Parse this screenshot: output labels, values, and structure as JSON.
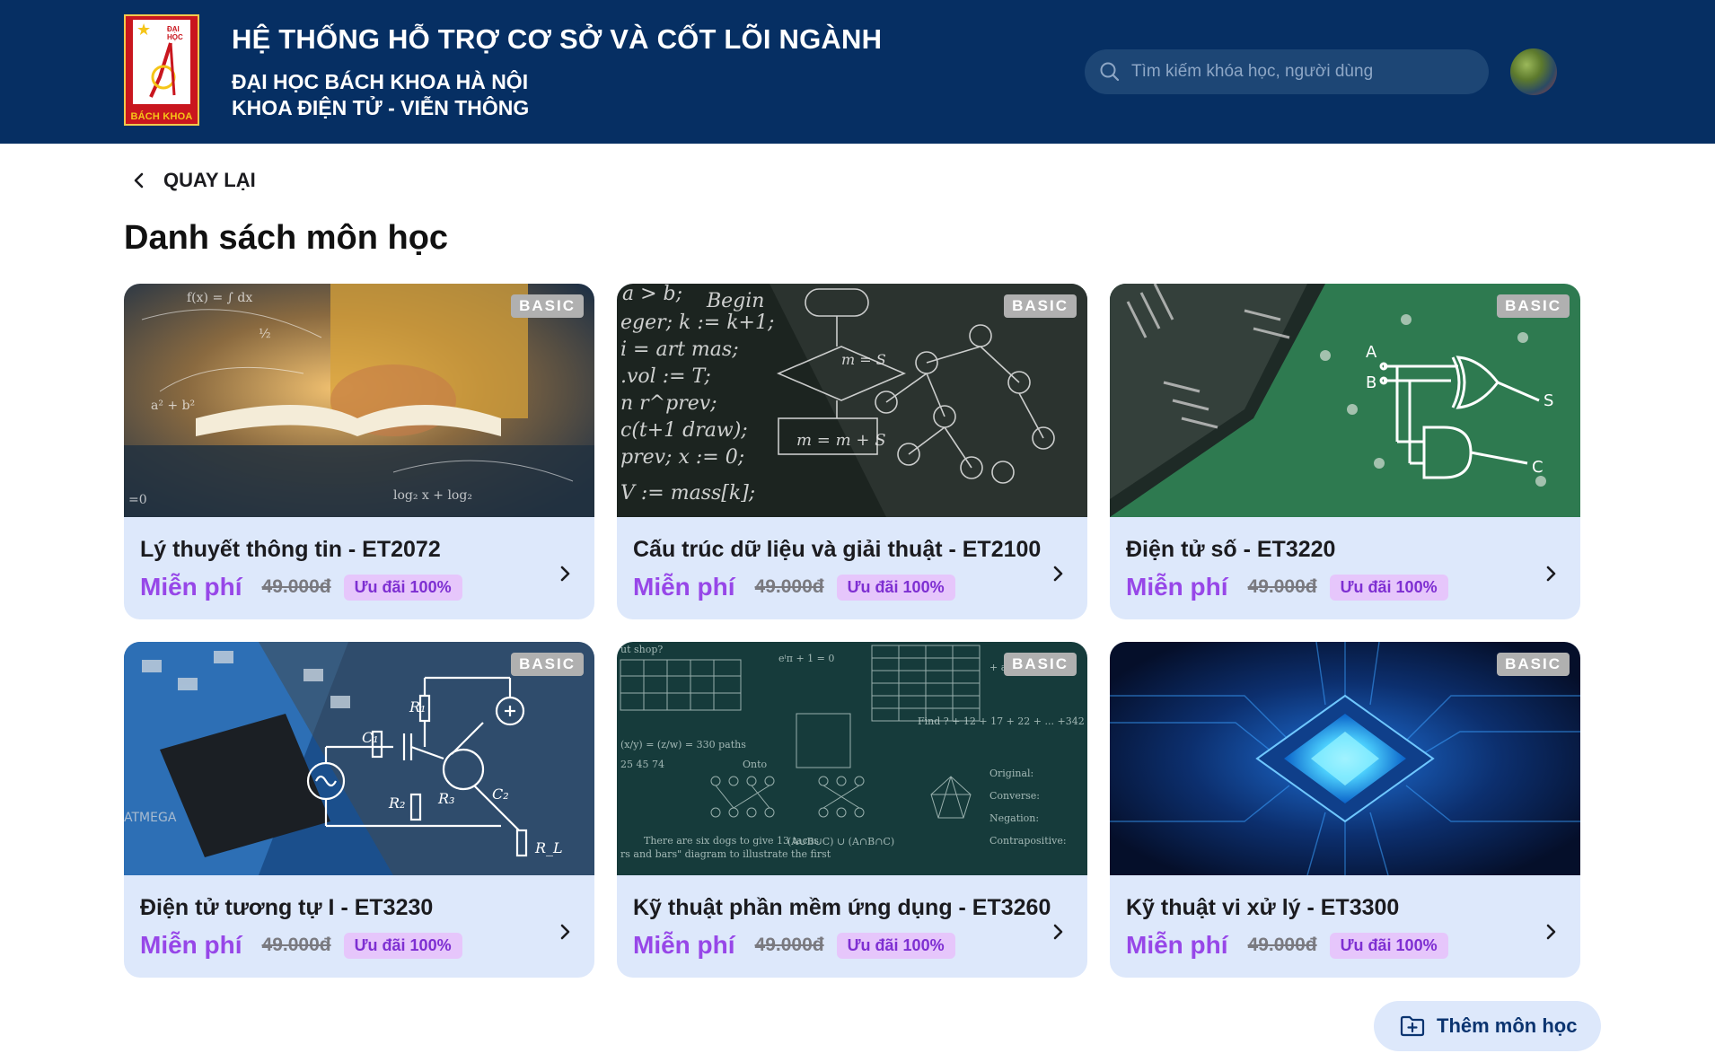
{
  "header": {
    "logo": {
      "top_text": "ĐẠI HỌC",
      "bottom_text": "BÁCH KHOA"
    },
    "title": "HỆ THỐNG HỖ TRỢ CƠ SỞ VÀ CỐT LÕI NGÀNH",
    "subtitle1": "ĐẠI HỌC BÁCH KHOA HÀ NỘI",
    "subtitle2": "KHOA ĐIỆN TỬ - VIỄN THÔNG",
    "search": {
      "placeholder": "Tìm kiếm khóa học, người dùng",
      "value": ""
    }
  },
  "back_label": "QUAY LẠI",
  "page_title": "Danh sách môn học",
  "courses": [
    {
      "name": "Lý thuyết thông tin - ET2072",
      "badge": "BASIC",
      "price": "Miễn phí",
      "old_price": "49.000đ",
      "promo": "Ưu đãi 100%",
      "image": "book-math"
    },
    {
      "name": "Cấu trúc dữ liệu và giải thuật - ET2100",
      "badge": "BASIC",
      "price": "Miễn phí",
      "old_price": "49.000đ",
      "promo": "Ưu đãi 100%",
      "image": "algorithm-chalkboard"
    },
    {
      "name": "Điện tử số - ET3220",
      "badge": "BASIC",
      "price": "Miễn phí",
      "old_price": "49.000đ",
      "promo": "Ưu đãi 100%",
      "image": "logic-gates-chip"
    },
    {
      "name": "Điện tử tương tự I - ET3230",
      "badge": "BASIC",
      "price": "Miễn phí",
      "old_price": "49.000đ",
      "promo": "Ưu đãi 100%",
      "image": "analog-circuit"
    },
    {
      "name": "Kỹ thuật phần mềm ứng dụng - ET3260",
      "badge": "BASIC",
      "price": "Miễn phí",
      "old_price": "49.000đ",
      "promo": "Ưu đãi 100%",
      "image": "math-chalkboard"
    },
    {
      "name": "Kỹ thuật vi xử lý - ET3300",
      "badge": "BASIC",
      "price": "Miễn phí",
      "old_price": "49.000đ",
      "promo": "Ưu đãi 100%",
      "image": "processor-glow"
    }
  ],
  "add_button": "Thêm môn học",
  "colors": {
    "header_bg": "#062f63",
    "card_bg": "#dde8fb",
    "price": "#9747e8",
    "promo_bg": "#e6c6fb",
    "accent": "#0b3470"
  },
  "icons": {
    "search": "search-icon",
    "back": "chevron-left-icon",
    "card_arrow": "chevron-right-icon",
    "add": "folder-plus-icon"
  }
}
